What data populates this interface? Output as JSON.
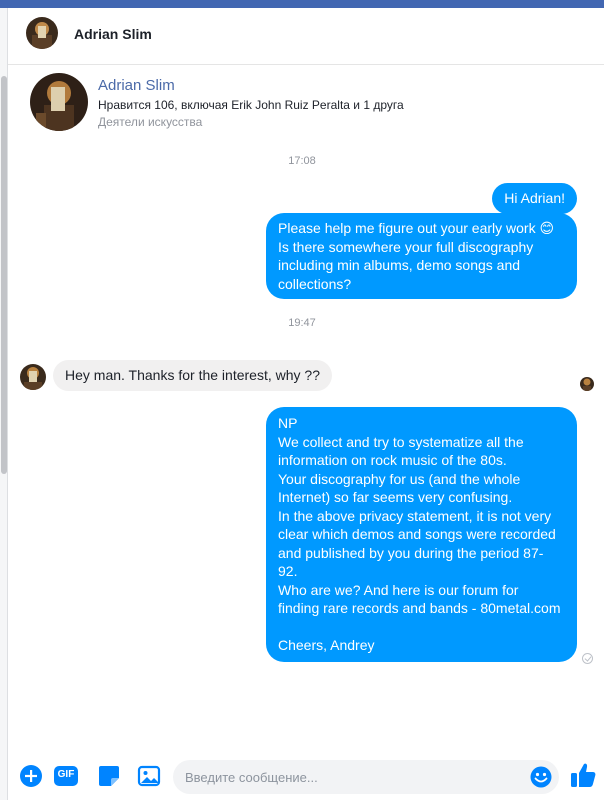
{
  "header": {
    "title": "Adrian Slim"
  },
  "profile": {
    "name": "Adrian Slim",
    "likes": "Нравится 106, включая Erik John Ruiz Peralta и 1 друга",
    "category": "Деятели искусства"
  },
  "timestamps": [
    "17:08",
    "19:47"
  ],
  "messages": {
    "out1": {
      "lines": [
        "Hi Adrian!"
      ]
    },
    "out2": {
      "lines": [
        "Please help me figure out your early work 😊",
        "Is there somewhere your full discography",
        "including min albums, demo songs and",
        "collections?"
      ]
    },
    "in1": {
      "lines": [
        "Hey man. Thanks for the interest, why ??"
      ]
    },
    "out3": {
      "lines": [
        "NP",
        "We collect and try to systematize all the",
        "information on rock music of the 80s.",
        "Your discography for us (and the whole",
        "Internet) so far seems very confusing.",
        "In the above privacy statement, it is not very",
        "clear which demos and songs were recorded",
        "and published by you during the period 87-",
        "92.",
        "Who are we? And here is our forum for",
        "finding rare records and bands - 80metal.com",
        "",
        "Cheers, Andrey"
      ]
    }
  },
  "composer": {
    "placeholder": "Введите сообщение...",
    "value": "",
    "gif_label": "GIF"
  },
  "colors": {
    "outgoing_bubble": "#0099ff",
    "incoming_bubble": "#f1f0f0",
    "accent": "#0084ff",
    "topbar": "#4267b2"
  },
  "icons": [
    "plus-icon",
    "gif-icon",
    "sticker-icon",
    "photo-icon",
    "emoji-icon",
    "thumbs-up-icon",
    "check-circle-icon"
  ]
}
